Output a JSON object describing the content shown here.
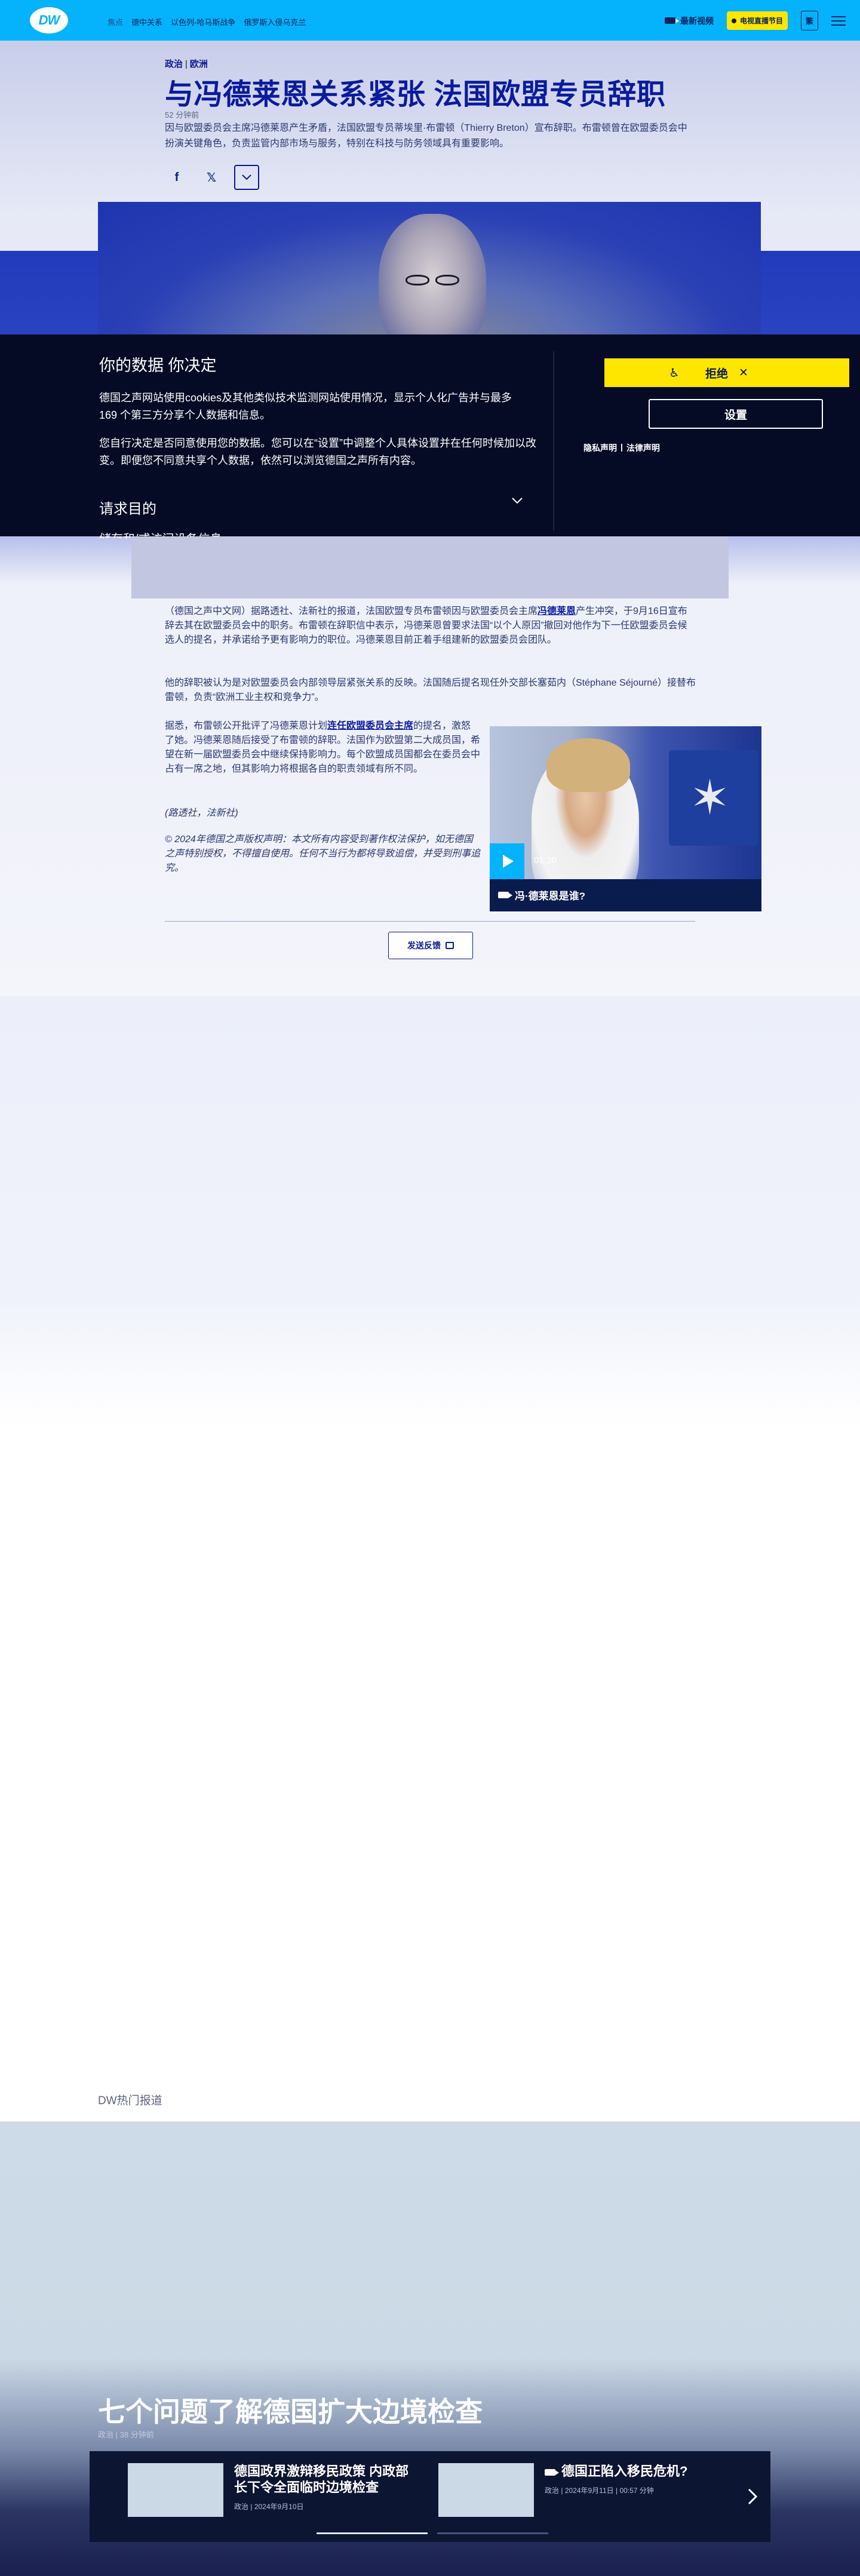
{
  "header": {
    "logo_text": "DW",
    "nav": [
      "焦点",
      "德中关系",
      "以色列-哈马斯战争",
      "俄罗斯入侵乌克兰"
    ],
    "latest_video": "最新视频",
    "live_tv": "电视直播节目",
    "lang": "繁"
  },
  "article": {
    "category": "政治",
    "subcategory": "欧洲",
    "title": "与冯德莱恩关系紧张 法国欧盟专员辞职",
    "time_ago": "52 分钟前",
    "lead": "因与欧盟委员会主席冯德莱恩产生矛盾，法国欧盟专员蒂埃里·布雷顿（Thierry Breton）宣布辞职。布雷顿曾在欧盟委员会中扮演关键角色，负责监管内部市场与服务，特别在科技与防务领域具有重要影响。",
    "p1_before": "（德国之声中文网）据路透社、法新社的报道，法国欧盟专员布雷顿因与欧盟委员会主席",
    "p1_link": "冯德莱恩",
    "p1_after": "产生冲突，于9月16日宣布辞去其在欧盟委员会中的职务。布雷顿在辞职信中表示，冯德莱恩曾要求法国“以个人原因”撤回对他作为下一任欧盟委员会候选人的提名，并承诺给予更有影响力的职位。冯德莱恩目前正着手组建新的欧盟委员会团队。",
    "p2": "他的辞职被认为是对欧盟委员会内部领导层紧张关系的反映。法国随后提名现任外交部长塞茹内（Stéphane Séjourné）接替布雷顿，负责“欧洲工业主权和竞争力”。",
    "p3_before": "据悉，布雷顿公开批评了冯德莱恩计划",
    "p3_link": "连任欧盟委员会主席",
    "p3_after": "的提名，激怒了她。冯德莱恩随后接受了布雷顿的辞职。法国作为欧盟第二大成员国，希望在新一届欧盟委员会中继续保持影响力。每个欧盟成员国都会在委员会中占有一席之地，但其影响力将根据各自的职责领域有所不同。",
    "source": "(路透社，法新社)",
    "copyright": "© 2024年德国之声版权声明：本文所有内容受到著作权法保护，如无德国之声特别授权，不得擅自使用。任何不当行为都将导致追偿，并受到刑事追究。",
    "feedback": "发送反馈"
  },
  "video": {
    "duration": "01:20",
    "title": "冯·德莱恩是谁?"
  },
  "cookie": {
    "title": "你的数据 你决定",
    "p1": "德国之声网站使用cookies及其他类似技术监测网站使用情况，显示个人化广告并与最多169 个第三方分享个人数据和信息。",
    "p2": "您自行决定是否同意使用您的数据。您可以在“设置”中调整个人具体设置并在任何时候加以改变。即便您不同意共享个人数据，依然可以浏览德国之声所有内容。",
    "reject": "拒绝",
    "settings": "设置",
    "privacy": "隐私声明",
    "legal": "法律声明",
    "purpose": "请求目的",
    "purpose_next": "储存和/或访问设备信息"
  },
  "top_stories": {
    "label": "DW热门报道",
    "feature_title": "七个问题了解德国扩大边境检查",
    "feature_category": "政治",
    "feature_time": "38 分钟前",
    "teasers": [
      {
        "title": "德国政界激辩移民政策 内政部长下令全面临时边境检查",
        "category": "政治",
        "date": "2024年9月10日"
      },
      {
        "title": "德国正陷入移民危机?",
        "category": "政治",
        "date": "2024年9月11日",
        "duration": "00:57 分钟"
      }
    ]
  },
  "colors": {
    "header_bg": "#05b2fc",
    "brand_dark": "#0a1b4e",
    "accent_yellow": "#ffe600",
    "cookie_bg": "#050b25"
  }
}
